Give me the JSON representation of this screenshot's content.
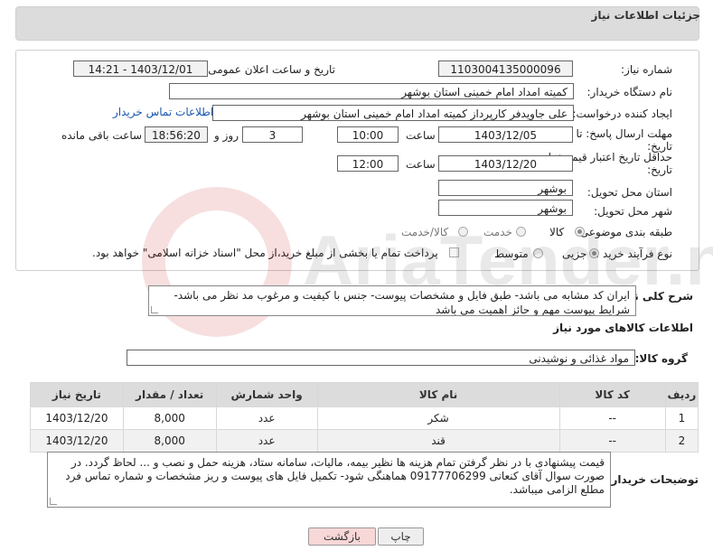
{
  "header": {
    "title": "جزئیات اطلاعات نیاز"
  },
  "form": {
    "need_number_label": "شماره نیاز:",
    "need_number": "1103004135000096",
    "announce_label": "تاریخ و ساعت اعلان عمومی:",
    "announce_value": "1403/12/01 - 14:21",
    "buyer_org_label": "نام دستگاه خریدار:",
    "buyer_org": "کمیته امداد امام خمینی استان بوشهر",
    "creator_label": "ایجاد کننده درخواست:",
    "creator": "علی جاویدفر کارپرداز کمیته امداد امام خمینی استان بوشهر",
    "contact_link": "اطلاعات تماس خریدار",
    "deadline_label_1": "مهلت ارسال پاسخ: تا",
    "deadline_label_2": "تاریخ:",
    "deadline_date": "1403/12/05",
    "hour_label": "ساعت",
    "deadline_time": "10:00",
    "days_value": "3",
    "days_label": "روز و",
    "remaining_time": "18:56:20",
    "remaining_label": "ساعت باقی مانده",
    "validity_label_1": "حداقل تاریخ اعتبار قیمت: تا",
    "validity_label_2": "تاریخ:",
    "validity_date": "1403/12/20",
    "validity_time": "12:00",
    "province_label": "استان محل تحویل:",
    "province": "بوشهر",
    "city_label": "شهر محل تحویل:",
    "city": "بوشهر",
    "category_label": "طبقه بندی موضوعی:",
    "category_options": [
      "کالا",
      "خدمت",
      "کالا/خدمت"
    ],
    "process_label": "نوع فرآیند خرید :",
    "process_options": [
      "جزیی",
      "متوسط"
    ],
    "payment_note": "پرداخت تمام یا بخشی از مبلغ خرید،از محل \"اسناد خزانه اسلامی\" خواهد بود."
  },
  "description": {
    "label": "شرح کلی نیاز:",
    "text": "ایران کد مشابه می باشد- طبق فایل و مشخصات پیوست- جنس با کیفیت و مرغوب مد نظر می باشد- شرایط پیوست مهم و حائز اهمیت می باشد"
  },
  "goods": {
    "section_title": "اطلاعات کالاهای مورد نیاز",
    "group_label": "گروه کالا:",
    "group_value": "مواد غذائی و نوشیدنی",
    "columns": [
      "ردیف",
      "کد کالا",
      "نام کالا",
      "واحد شمارش",
      "تعداد / مقدار",
      "تاریخ نیاز"
    ],
    "rows": [
      [
        "1",
        "--",
        "شکر",
        "عدد",
        "8,000",
        "1403/12/20"
      ],
      [
        "2",
        "--",
        "قند",
        "عدد",
        "8,000",
        "1403/12/20"
      ]
    ]
  },
  "notes": {
    "label": "توضیحات خریدار:",
    "text": "قیمت پیشنهادی با در نظر گرفتن تمام هزینه ها نظیر بیمه، مالیات، سامانه ستاد، هزینه حمل و نصب و ... لحاظ گردد. در صورت سوال آقای کنعانی 09177706299 هماهنگی شود- تکمیل فایل های پیوست و ریز مشخصات و شماره تماس فرد مطلع الزامی میباشد."
  },
  "buttons": {
    "print": "چاپ",
    "back": "بازگشت"
  },
  "colors": {
    "header_bg": "#dcdcdc",
    "link": "#1a57b0",
    "back_button": "#f8d7d7"
  }
}
